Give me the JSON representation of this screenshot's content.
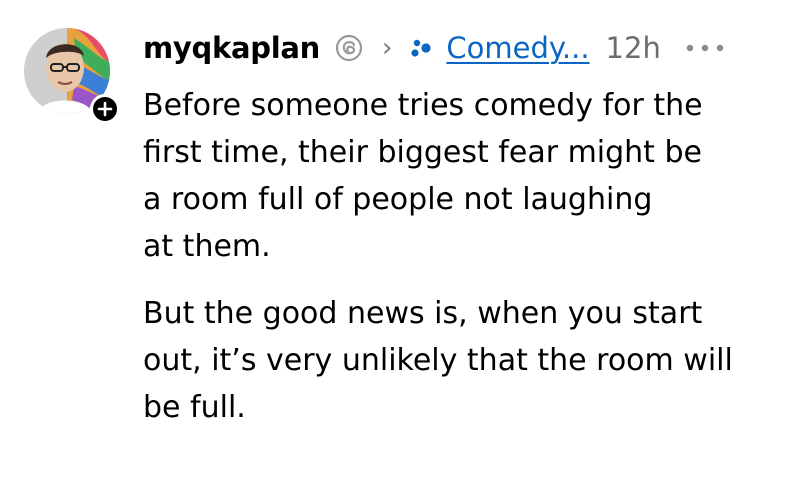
{
  "post": {
    "author": {
      "username": "myqkaplan",
      "avatar_icon": "profile-avatar",
      "follow_icon": "plus-icon"
    },
    "header": {
      "separator_icon": "chevron-right-icon",
      "community_icon": "community-dots-icon",
      "community_label": "Comedy...",
      "timestamp": "12h",
      "more_icon": "more-horizontal-icon"
    },
    "body": {
      "paragraph_1_lines": [
        "Before someone tries comedy for the",
        "first time, their biggest fear might be",
        "a room full of people not laughing",
        "at them."
      ],
      "paragraph_2_lines": [
        "But the good news is, when you start",
        "out, it’s very unlikely that the room will",
        "be full."
      ]
    },
    "colors": {
      "link": "#0a66c2",
      "muted": "#6d6d6d",
      "text": "#000000"
    }
  }
}
